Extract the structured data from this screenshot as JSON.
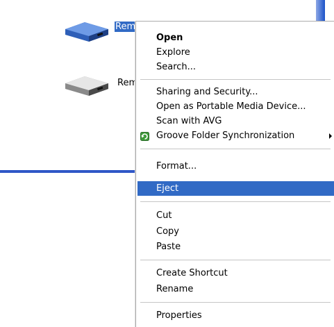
{
  "desktop": {
    "drive1_label": "Rem",
    "drive2_label": "Rem"
  },
  "menu": {
    "items": [
      {
        "label": "Open"
      },
      {
        "label": "Explore"
      },
      {
        "label": "Search..."
      },
      {
        "label": "Sharing and Security..."
      },
      {
        "label": "Open as Portable Media Device..."
      },
      {
        "label": "Scan with AVG"
      },
      {
        "label": "Groove Folder Synchronization"
      },
      {
        "label": "Format..."
      },
      {
        "label": "Eject"
      },
      {
        "label": "Cut"
      },
      {
        "label": "Copy"
      },
      {
        "label": "Paste"
      },
      {
        "label": "Create Shortcut"
      },
      {
        "label": "Rename"
      },
      {
        "label": "Properties"
      }
    ],
    "highlighted": "Eject",
    "highlight_color": "#316ac5"
  }
}
